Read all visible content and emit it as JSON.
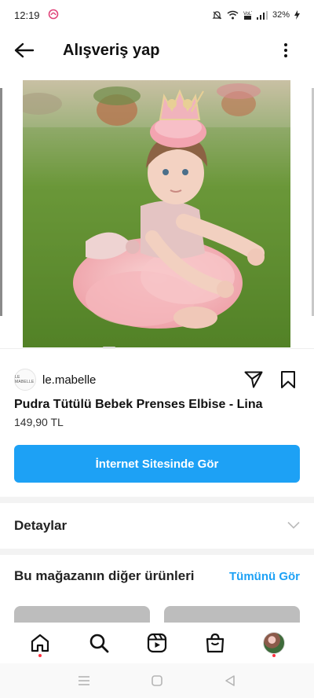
{
  "status_bar": {
    "time": "12:19",
    "battery": "32%"
  },
  "header": {
    "title": "Alışveriş yap"
  },
  "product": {
    "photo_alt": "",
    "shop_avatar_text": "LE MABELLE",
    "shop_name": "le.mabelle",
    "title": "Pudra Tütülü Bebek Prenses Elbise - Lina",
    "price": "149,90 TL",
    "website_button": "İnternet Sitesinde Gör"
  },
  "details": {
    "label": "Detaylar"
  },
  "more_products": {
    "label": "Bu mağazanın diğer ürünleri",
    "see_all": "Tümünü Gör"
  },
  "colors": {
    "accent_blue": "#1da1f5",
    "notification_red": "#ff3040"
  },
  "icons": {
    "back": "arrow-left-icon",
    "more": "more-vertical-icon",
    "share": "send-icon",
    "save": "bookmark-icon",
    "chevron": "chevron-down-icon",
    "nav": [
      "home-icon",
      "search-icon",
      "reels-icon",
      "shop-icon",
      "profile-avatar"
    ],
    "system": [
      "recent-apps-icon",
      "home-square-icon",
      "back-triangle-icon"
    ]
  }
}
